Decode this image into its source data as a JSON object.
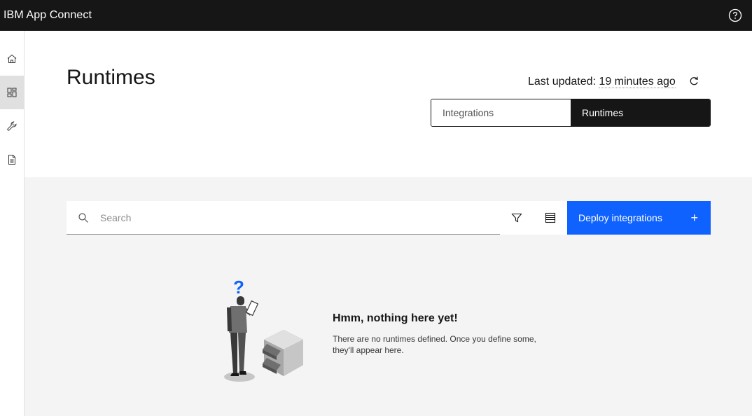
{
  "app": {
    "brand_primary": "IBM",
    "brand_secondary": "App Connect"
  },
  "icons": {
    "help": "help-icon",
    "home": "home-icon",
    "dashboard": "dashboard-icon",
    "tools": "wrench-icon",
    "docs": "document-icon",
    "refresh": "refresh-icon",
    "search": "search-icon",
    "filter": "filter-icon",
    "view": "list-view-icon"
  },
  "page": {
    "title": "Runtimes",
    "last_updated_label": "Last updated:",
    "last_updated_value": "19 minutes ago"
  },
  "switcher": {
    "options": [
      "Integrations",
      "Runtimes"
    ],
    "selected": "Runtimes"
  },
  "toolbar": {
    "search_placeholder": "Search",
    "search_value": "",
    "deploy_label": "Deploy integrations",
    "deploy_icon": "+"
  },
  "empty_state": {
    "title": "Hmm, nothing here yet!",
    "body": "There are no runtimes defined. Once you define some, they'll appear here."
  },
  "colors": {
    "topbar": "#161616",
    "primary": "#0f62fe",
    "content_bg": "#f4f4f4",
    "question_mark": "#0f62fe"
  }
}
